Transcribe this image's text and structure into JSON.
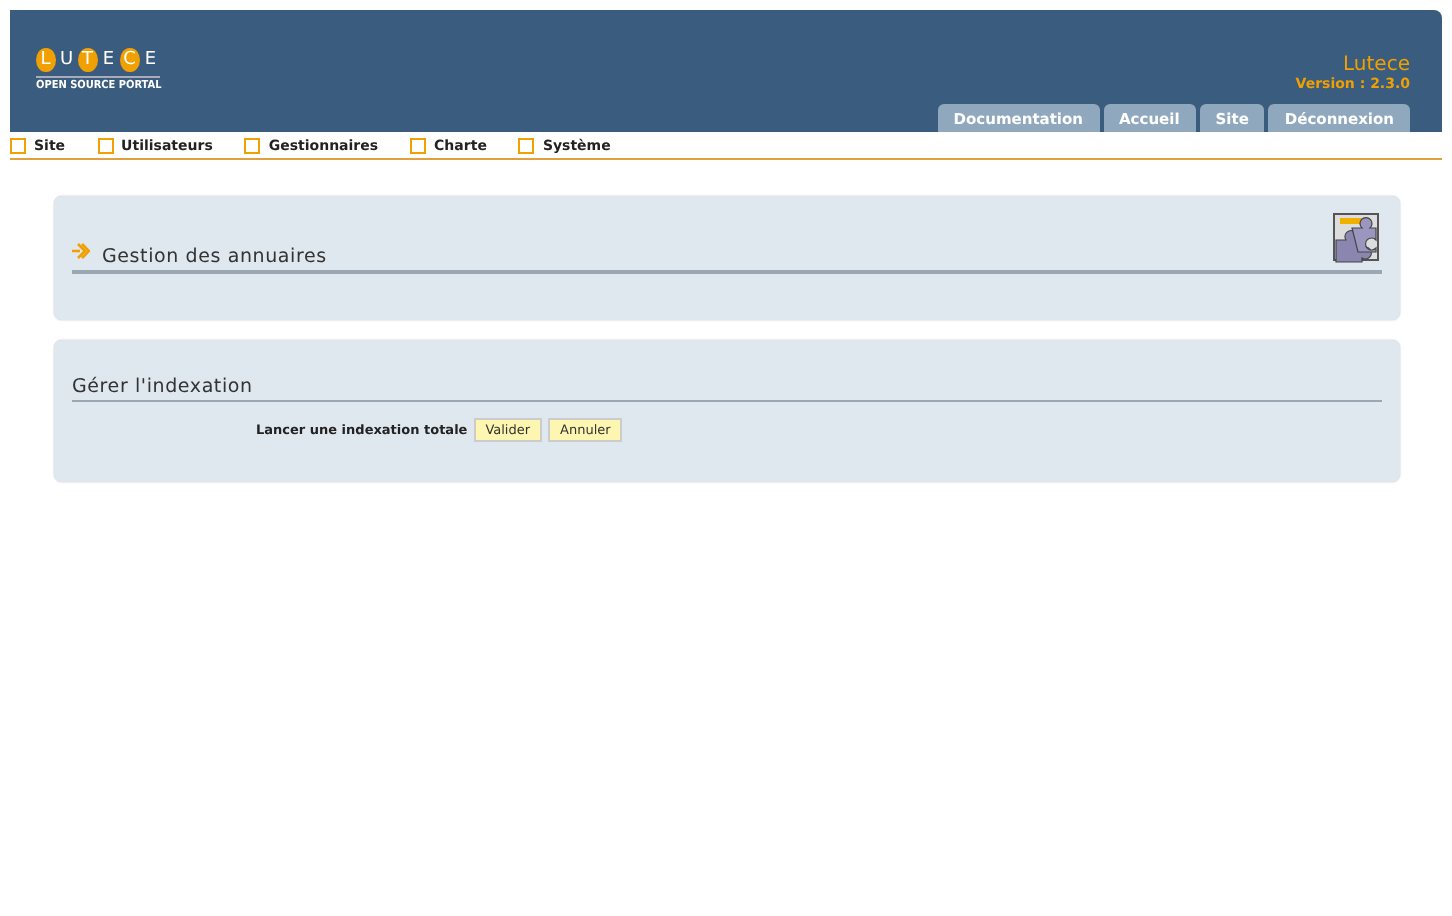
{
  "logo": {
    "letters": [
      {
        "char": "L",
        "circled": true
      },
      {
        "char": "U",
        "circled": false
      },
      {
        "char": "T",
        "circled": true
      },
      {
        "char": "E",
        "circled": false
      },
      {
        "char": "C",
        "circled": true
      },
      {
        "char": "E",
        "circled": false
      }
    ],
    "tagline": "OPEN SOURCE PORTAL"
  },
  "site": {
    "name": "Lutece",
    "version": "Version : 2.3.0"
  },
  "tabs": [
    {
      "label": "Documentation"
    },
    {
      "label": "Accueil"
    },
    {
      "label": "Site"
    },
    {
      "label": "Déconnexion"
    }
  ],
  "menu": [
    {
      "label": "Site"
    },
    {
      "label": "Utilisateurs"
    },
    {
      "label": "Gestionnaires"
    },
    {
      "label": "Charte"
    },
    {
      "label": "Système"
    }
  ],
  "panels": [
    {
      "kind": "header",
      "title": "Gestion des annuaires"
    },
    {
      "kind": "form",
      "title": "Gérer l'indexation",
      "label": "Lancer une indexation totale",
      "buttons": [
        "Valider",
        "Annuler"
      ]
    }
  ]
}
